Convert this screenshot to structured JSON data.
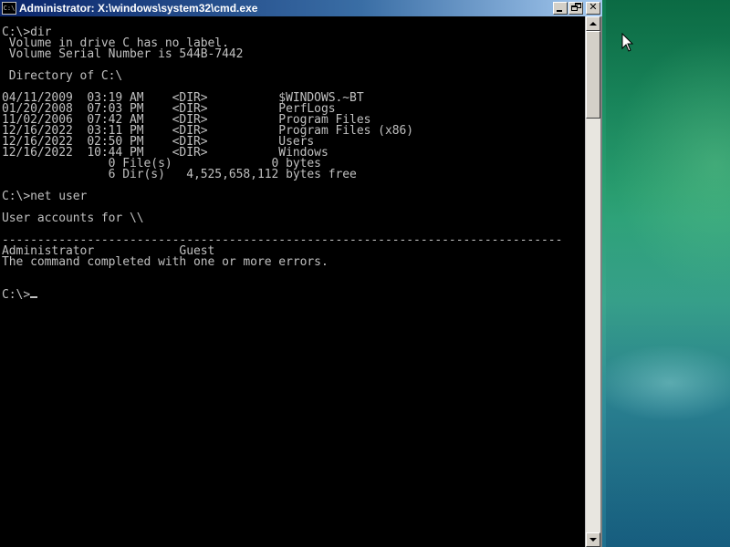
{
  "window": {
    "title": "Administrator: X:\\windows\\system32\\cmd.exe",
    "icon_label": "C:\\"
  },
  "title_buttons": {
    "minimize_icon": "minimize-icon",
    "restore_icon": "restore-icon",
    "close_glyph": "✕"
  },
  "console": {
    "lines": [
      "C:\\>dir",
      " Volume in drive C has no label.",
      " Volume Serial Number is 544B-7442",
      "",
      " Directory of C:\\",
      "",
      "04/11/2009  03:19 AM    <DIR>          $WINDOWS.~BT",
      "01/20/2008  07:03 PM    <DIR>          PerfLogs",
      "11/02/2006  07:42 AM    <DIR>          Program Files",
      "12/16/2022  03:11 PM    <DIR>          Program Files (x86)",
      "12/16/2022  02:50 PM    <DIR>          Users",
      "12/16/2022  10:44 PM    <DIR>          Windows",
      "               0 File(s)              0 bytes",
      "               6 Dir(s)   4,525,658,112 bytes free",
      "",
      "C:\\>net user",
      "",
      "User accounts for \\\\",
      "",
      "-------------------------------------------------------------------------------",
      "Administrator            Guest",
      "The command completed with one or more errors.",
      "",
      "",
      "C:\\>"
    ]
  },
  "colors": {
    "console_background": "#000000",
    "console_text": "#c0c0c0",
    "titlebar_start": "#0a246a",
    "titlebar_end": "#a6caf0"
  }
}
